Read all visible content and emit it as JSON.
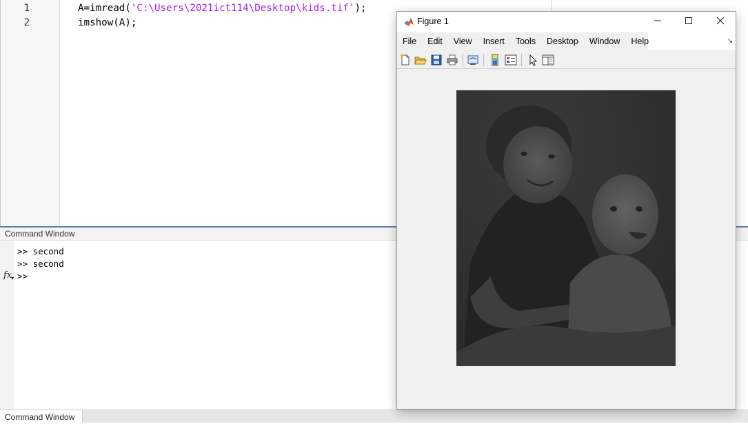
{
  "editor": {
    "lines": [
      {
        "num": "1",
        "code_prefix": "A=imread(",
        "code_string": "'C:\\Users\\2021ict114\\Desktop\\kids.tif'",
        "code_suffix": ");"
      },
      {
        "num": "2",
        "code_prefix": "imshow(A);",
        "code_string": "",
        "code_suffix": ""
      }
    ],
    "colors": {
      "string": "#a020f0",
      "keyword_text": "#000000"
    }
  },
  "command_window": {
    "title": "Command Window",
    "lines": [
      ">> second",
      ">> second"
    ],
    "prompt": ">>",
    "fx_icon": "fx"
  },
  "bottom_tab": {
    "label": "Command Window"
  },
  "figure": {
    "title": "Figure 1",
    "logo_icon": "matlab-logo-icon",
    "window_buttons": {
      "minimize": "—",
      "maximize": "☐",
      "close": "✕"
    },
    "menu": [
      "File",
      "Edit",
      "View",
      "Insert",
      "Tools",
      "Desktop",
      "Window",
      "Help"
    ],
    "menu_overflow": "↘",
    "toolbar": [
      {
        "name": "new-figure-icon"
      },
      {
        "name": "open-file-icon"
      },
      {
        "name": "save-icon"
      },
      {
        "name": "print-icon"
      },
      {
        "name": "link-plot-icon"
      },
      {
        "name": "insert-colorbar-icon"
      },
      {
        "name": "insert-legend-icon"
      },
      {
        "name": "edit-plot-pointer-icon"
      },
      {
        "name": "property-inspector-icon"
      }
    ],
    "image": {
      "description_icon": "grayscale-photo-kids-image",
      "tone": "#303030"
    }
  }
}
